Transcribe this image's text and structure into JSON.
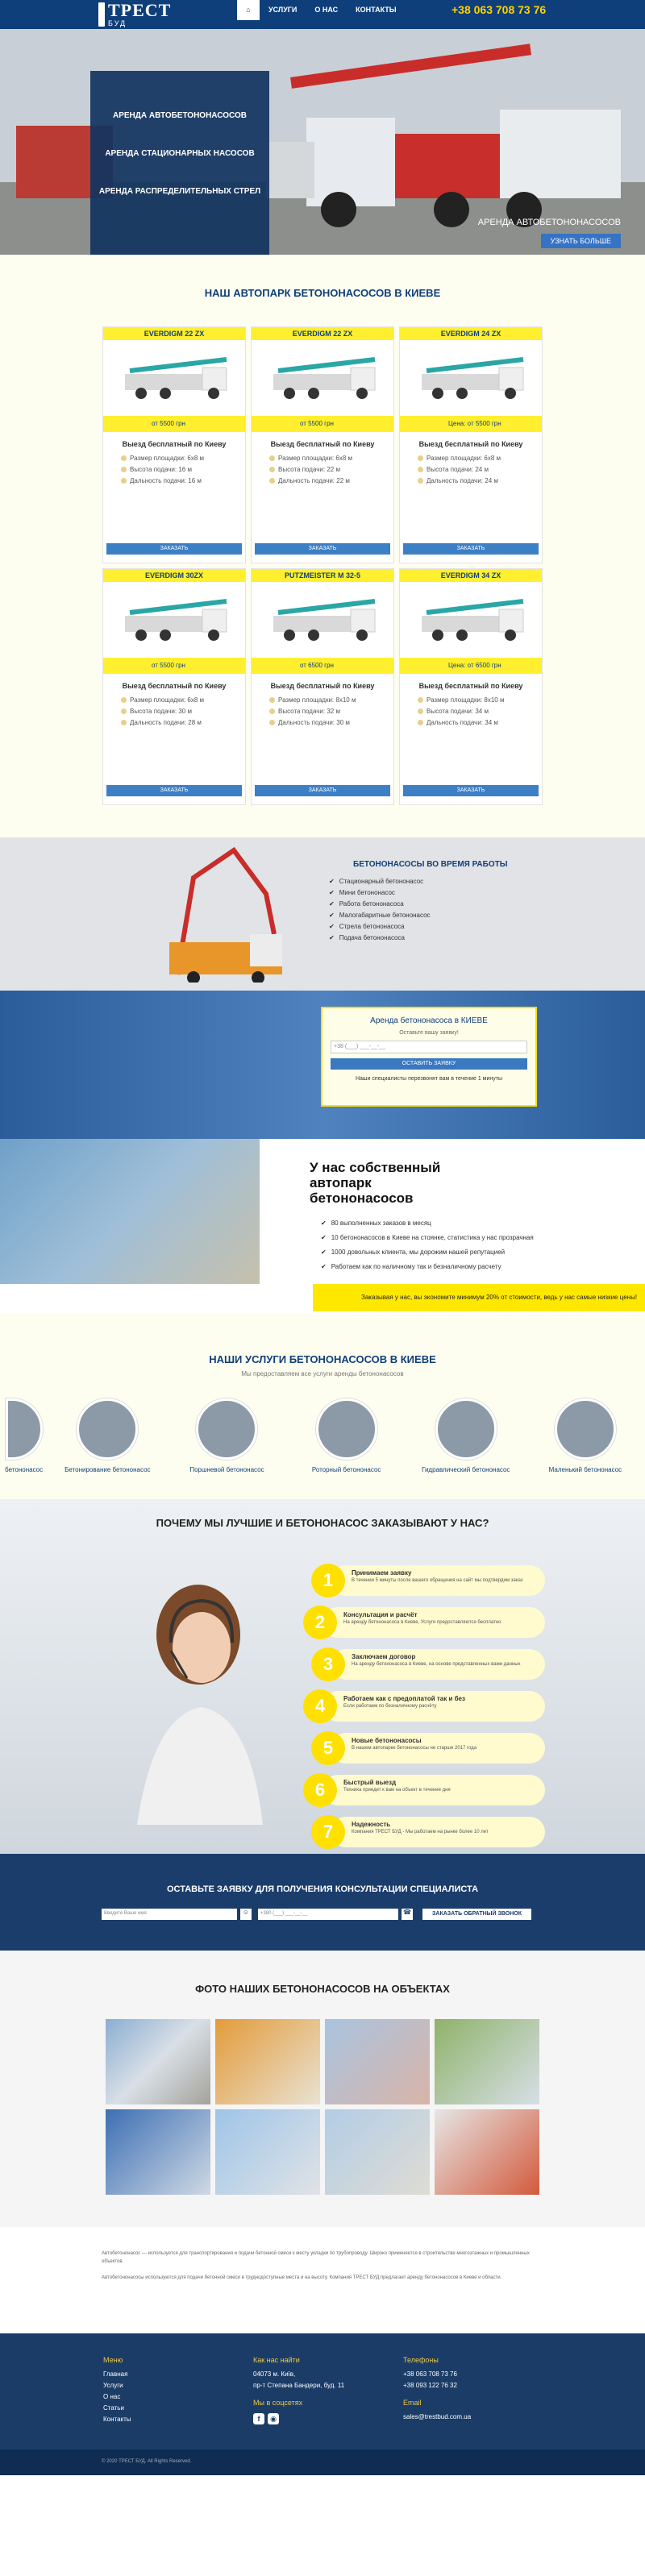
{
  "brand": {
    "name": "ТРЕСТ",
    "sub": "БУД"
  },
  "nav": {
    "items": [
      "УСЛУГИ",
      "О НАС",
      "КОНТАКТЫ"
    ]
  },
  "phone": "+38 063 708 73 76",
  "hero": {
    "menu": [
      "АРЕНДА АВТОБЕТОНОНАСОСОВ",
      "АРЕНДА СТАЦИОНАРНЫХ НАСОСОВ",
      "АРЕНДА РАСПРЕДЕЛИТЕЛЬНЫХ СТРЕЛ"
    ],
    "caption": "АРЕНДА АВТОБЕТОНОНАСОСОВ",
    "button": "УЗНАТЬ БОЛЬШЕ"
  },
  "park": {
    "title": "НАШ АВТОПАРК БЕТОНОНАСОСОВ В КИЕВЕ",
    "free": "Выезд бесплатный по Киеву",
    "button": "ЗАКАЗАТЬ",
    "cards": [
      {
        "model": "EVERDIGM 22 ZX",
        "price": "от 5500 грн",
        "specs": [
          "Размер площадки: 6х8 м",
          "Высота подачи: 16 м",
          "Дальность подачи: 16 м"
        ]
      },
      {
        "model": "EVERDIGM 22 ZX",
        "price": "от 5500 грн",
        "specs": [
          "Размер площадки: 6х8 м",
          "Высота подачи: 22 м",
          "Дальность подачи: 22 м"
        ]
      },
      {
        "model": "EVERDIGM 24 ZX",
        "price": "Цена: от 5500 грн",
        "specs": [
          "Размер площадки: 6х8 м",
          "Высота подачи: 24 м",
          "Дальность подачи: 24 м"
        ]
      },
      {
        "model": "EVERDIGM 30ZX",
        "price": "от 5500 грн",
        "specs": [
          "Размер площадки: 6х8 м",
          "Высота подачи: 30 м",
          "Дальность подачи: 28 м"
        ]
      },
      {
        "model": "PUTZMEISTER M 32-5",
        "price": "от 6500 грн",
        "specs": [
          "Размер площадки: 8х10 м",
          "Высота подачи: 32 м",
          "Дальность подачи: 30 м"
        ]
      },
      {
        "model": "EVERDIGM 34 ZX",
        "price": "Цена: от 6500 грн",
        "specs": [
          "Размер площадки: 8х10 м",
          "Высота подачи: 34 м",
          "Дальность подачи: 34 м"
        ]
      }
    ]
  },
  "work": {
    "title": "БЕТОНОНАСОСЫ ВО ВРЕМЯ РАБОТЫ",
    "items": [
      "Стационарный бетононасос",
      "Мини бетононасос",
      "Работа бетононасоса",
      "Малогабаритные бетононасос",
      "Стрела бетононасоса",
      "Подача бетононасоса"
    ]
  },
  "apply": {
    "title": "Аренда бетононасоса в КИЕВЕ",
    "sub": "Оставьте вашу заявку!",
    "placeholder": "+38 (___) ___-__-__",
    "button": "ОСТАВИТЬ ЗАЯВКУ",
    "note": "Наши специалисты перезвонят вам в течение 1 минуты"
  },
  "own": {
    "title": "У нас собственный автопарк бетононасосов",
    "items": [
      "80 выполненных заказов в месяц",
      "10 бетононасосов в Киеве на стоянке, статистика у нас прозрачная",
      "1000 довольных клиента, мы дорожим нашей репутацией",
      "Работаем как по наличному так и безналичному расчету"
    ],
    "banner": "Заказывая у нас, вы экономите минимум 20% от стоимости, ведь у нас самые низкие цены!"
  },
  "services": {
    "title": "НАШИ УСЛУГИ БЕТОНОНАСОСОВ В КИЕВЕ",
    "sub": "Мы предоставляем все услуги аренды бетононасосов",
    "items": [
      "бетононасос",
      "Бетонирование бетононасос",
      "Поршневой бетононасос",
      "Роторный бетононасос",
      "Гидравлический бетононасос",
      "Маленький бетононасос"
    ]
  },
  "why": {
    "title": "ПОЧЕМУ МЫ ЛУЧШИЕ И БЕТОНОНАСОС ЗАКАЗЫВАЮТ У НАС?",
    "steps": [
      {
        "n": "1",
        "a": "Принимаем заявку",
        "b": "В течении 5 минуты после вашего обращения на сайт мы подтвердим заказ"
      },
      {
        "n": "2",
        "a": "Консультация и расчёт",
        "b": "На аренду бетононасоса в Киеве, Услуги предоставляются бесплатно"
      },
      {
        "n": "3",
        "a": "Заключаем договор",
        "b": "На аренду бетононасоса в Киеве, на основе представленных вами данных"
      },
      {
        "n": "4",
        "a": "Работаем как с предоплатой так и без",
        "b": "Если работаем по безналичному расчёту"
      },
      {
        "n": "5",
        "a": "Новые бетононасосы",
        "b": "В нашем автопарке бетононасосы не старше 2017 года"
      },
      {
        "n": "6",
        "a": "Быстрый выезд",
        "b": "Техника приедет к вам на объект в течение дня"
      },
      {
        "n": "7",
        "a": "Надежность",
        "b": "Компания ТРЕСТ БУД - Мы работаем на рынке более 10 лет"
      }
    ]
  },
  "consult": {
    "title": "ОСТАВЬТЕ ЗАЯВКУ ДЛЯ ПОЛУЧЕНИЯ КОНСУЛЬТАЦИИ СПЕЦИАЛИСТА",
    "name_ph": "Введите Ваше имя",
    "phone_ph": "+380 (___) ___-__-__",
    "button": "ЗАКАЗАТЬ ОБРАТНЫЙ ЗВОНОК"
  },
  "photos": {
    "title": "ФОТО НАШИХ БЕТОНОНАСОСОВ НА ОБЪЕКТАХ"
  },
  "text": {
    "p1": "Автобетононасос — используется для транспортирования и подачи бетонной смеси к месту укладки по трубопроводу. Широко применяется в строительстве многоэтажных и промышленных объектов.",
    "p2": "Автобетононасосы используются для подачи бетонной смеси в труднодоступные места и на высоту. Компания ТРЕСТ БУД предлагает аренду бетононасосов в Киеве и области."
  },
  "footer": {
    "menu_h": "Меню",
    "menu": [
      "Главная",
      "Услуги",
      "О нас",
      "Статьи",
      "Контакты"
    ],
    "addr_h": "Как нас найти",
    "addr": [
      "04073 м. Київ,",
      "пр-т Степана Бандери, буд. 11"
    ],
    "social_h": "Мы в соцсетях",
    "phones_h": "Телефоны",
    "phones": [
      "+38 063 708 73 76",
      "+38 093 122 76 32"
    ],
    "email_h": "Email",
    "email": "sales@trestbud.com.ua"
  },
  "copy": {
    "left": "© 2020 ТРЕСТ БУД. All Rights Reserved."
  }
}
